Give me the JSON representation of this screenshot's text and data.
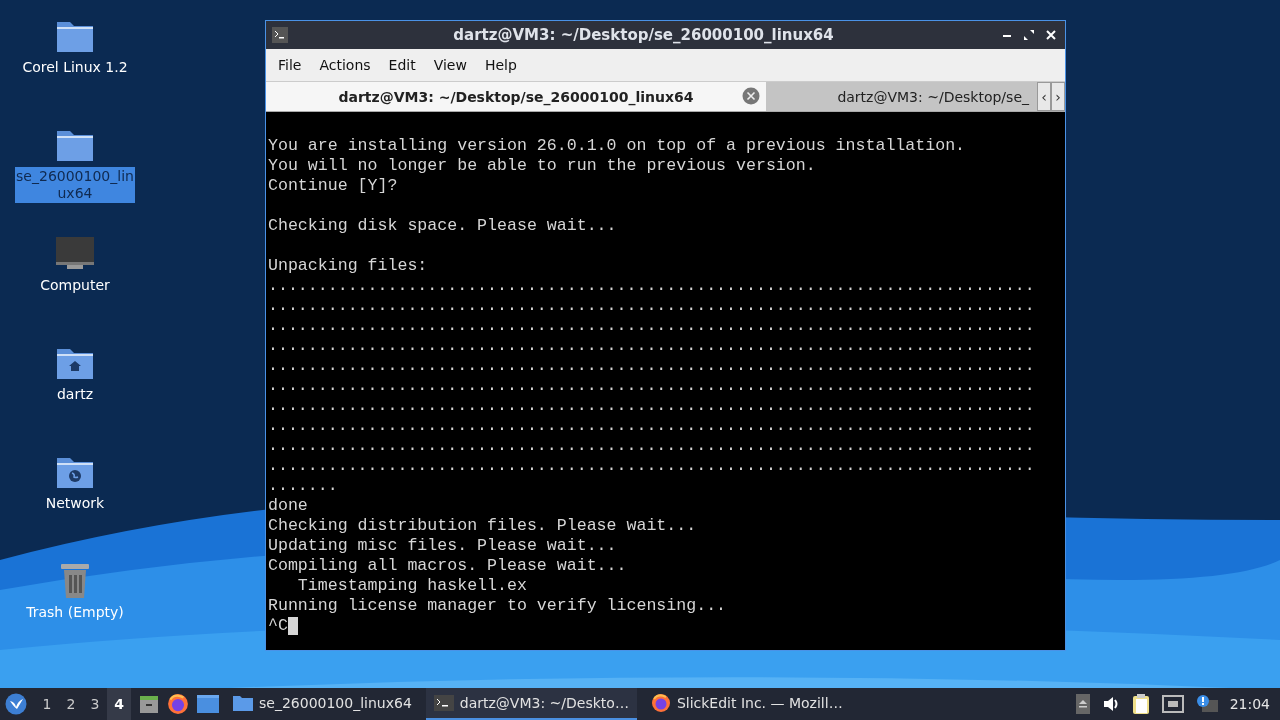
{
  "desktop_icons": [
    {
      "kind": "folder",
      "label": "Corel Linux 1.2",
      "selected": false
    },
    {
      "kind": "folder",
      "label": "se_26000100_linux64",
      "selected": true
    },
    {
      "kind": "computer",
      "label": "Computer",
      "selected": false
    },
    {
      "kind": "home",
      "label": "dartz",
      "selected": false
    },
    {
      "kind": "network",
      "label": "Network",
      "selected": false
    },
    {
      "kind": "trash",
      "label": "Trash (Empty)",
      "selected": false
    }
  ],
  "window": {
    "title": "dartz@VM3: ~/Desktop/se_26000100_linux64",
    "menu": [
      "File",
      "Actions",
      "Edit",
      "View",
      "Help"
    ],
    "tabs": [
      {
        "label": "dartz@VM3: ~/Desktop/se_26000100_linux64",
        "selected": true
      },
      {
        "label": "dartz@VM3: ~/Desktop/se_",
        "selected": false
      }
    ],
    "tab_scroll": [
      "‹",
      "›"
    ],
    "terminal": {
      "paragraphs": [
        [
          "You are installing version 26.0.1.0 on top of a previous installation.",
          "You will no longer be able to run the previous version.",
          "Continue [Y]?"
        ],
        [
          "Checking disk space. Please wait..."
        ],
        [
          "Unpacking files:",
          ".............................................................................",
          ".............................................................................",
          ".............................................................................",
          ".............................................................................",
          ".............................................................................",
          ".............................................................................",
          ".............................................................................",
          ".............................................................................",
          ".............................................................................",
          ".............................................................................",
          ".......",
          "done",
          "Checking distribution files. Please wait...",
          "Updating misc files. Please wait...",
          "Compiling all macros. Please wait...",
          "   Timestamping haskell.ex",
          "Running license manager to verify licensing..."
        ]
      ],
      "prompt": "^C"
    }
  },
  "taskbar": {
    "workspaces": [
      {
        "label": "1",
        "selected": false
      },
      {
        "label": "2",
        "selected": false
      },
      {
        "label": "3",
        "selected": false
      },
      {
        "label": "4",
        "selected": true
      }
    ],
    "tasks": [
      {
        "kind": "folder",
        "label": "se_26000100_linux64",
        "selected": false
      },
      {
        "kind": "terminal",
        "label": "dartz@VM3: ~/Deskto…",
        "selected": true
      },
      {
        "kind": "firefox",
        "label": "SlickEdit Inc. — Mozill…",
        "selected": false
      }
    ],
    "clock": "21:04"
  }
}
